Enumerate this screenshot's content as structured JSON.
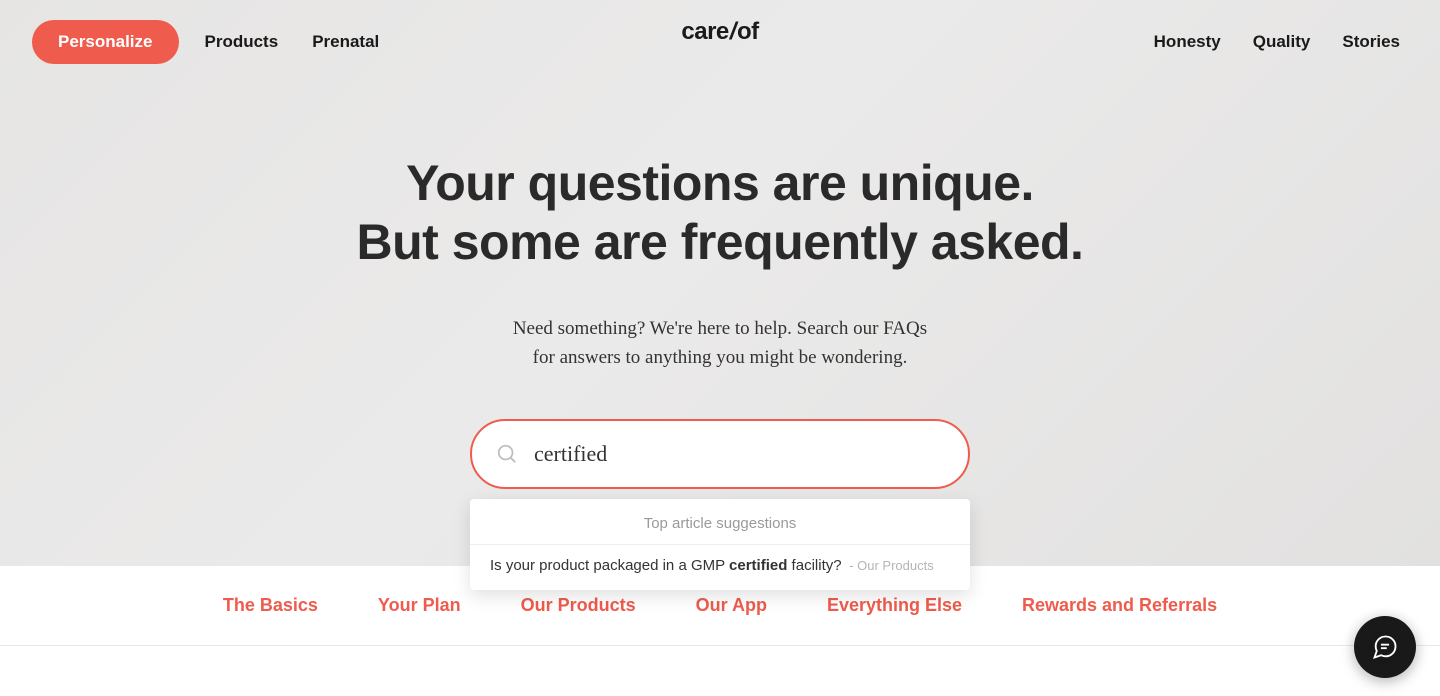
{
  "brand": {
    "name": "care/of",
    "part1": "care",
    "slash": "/",
    "part2": "of"
  },
  "nav": {
    "cta": "Personalize",
    "left": [
      "Products",
      "Prenatal"
    ],
    "right": [
      "Honesty",
      "Quality",
      "Stories"
    ]
  },
  "hero": {
    "title_line1": "Your questions are unique.",
    "title_line2": "But some are frequently asked.",
    "sub_line1": "Need something? We're here to help. Search our FAQs",
    "sub_line2": "for answers to anything you might be wondering."
  },
  "search": {
    "value": "certified",
    "placeholder": "",
    "suggestions_header": "Top article suggestions",
    "suggestions": [
      {
        "pre": "Is your product packaged in a GMP ",
        "match": "certified",
        "post": " facility?",
        "tag": " - Our Products"
      }
    ]
  },
  "categories": [
    "The Basics",
    "Your Plan",
    "Our Products",
    "Our App",
    "Everything Else",
    "Rewards and Referrals"
  ],
  "colors": {
    "accent": "#ef5b4c",
    "text": "#1a1a1a"
  }
}
